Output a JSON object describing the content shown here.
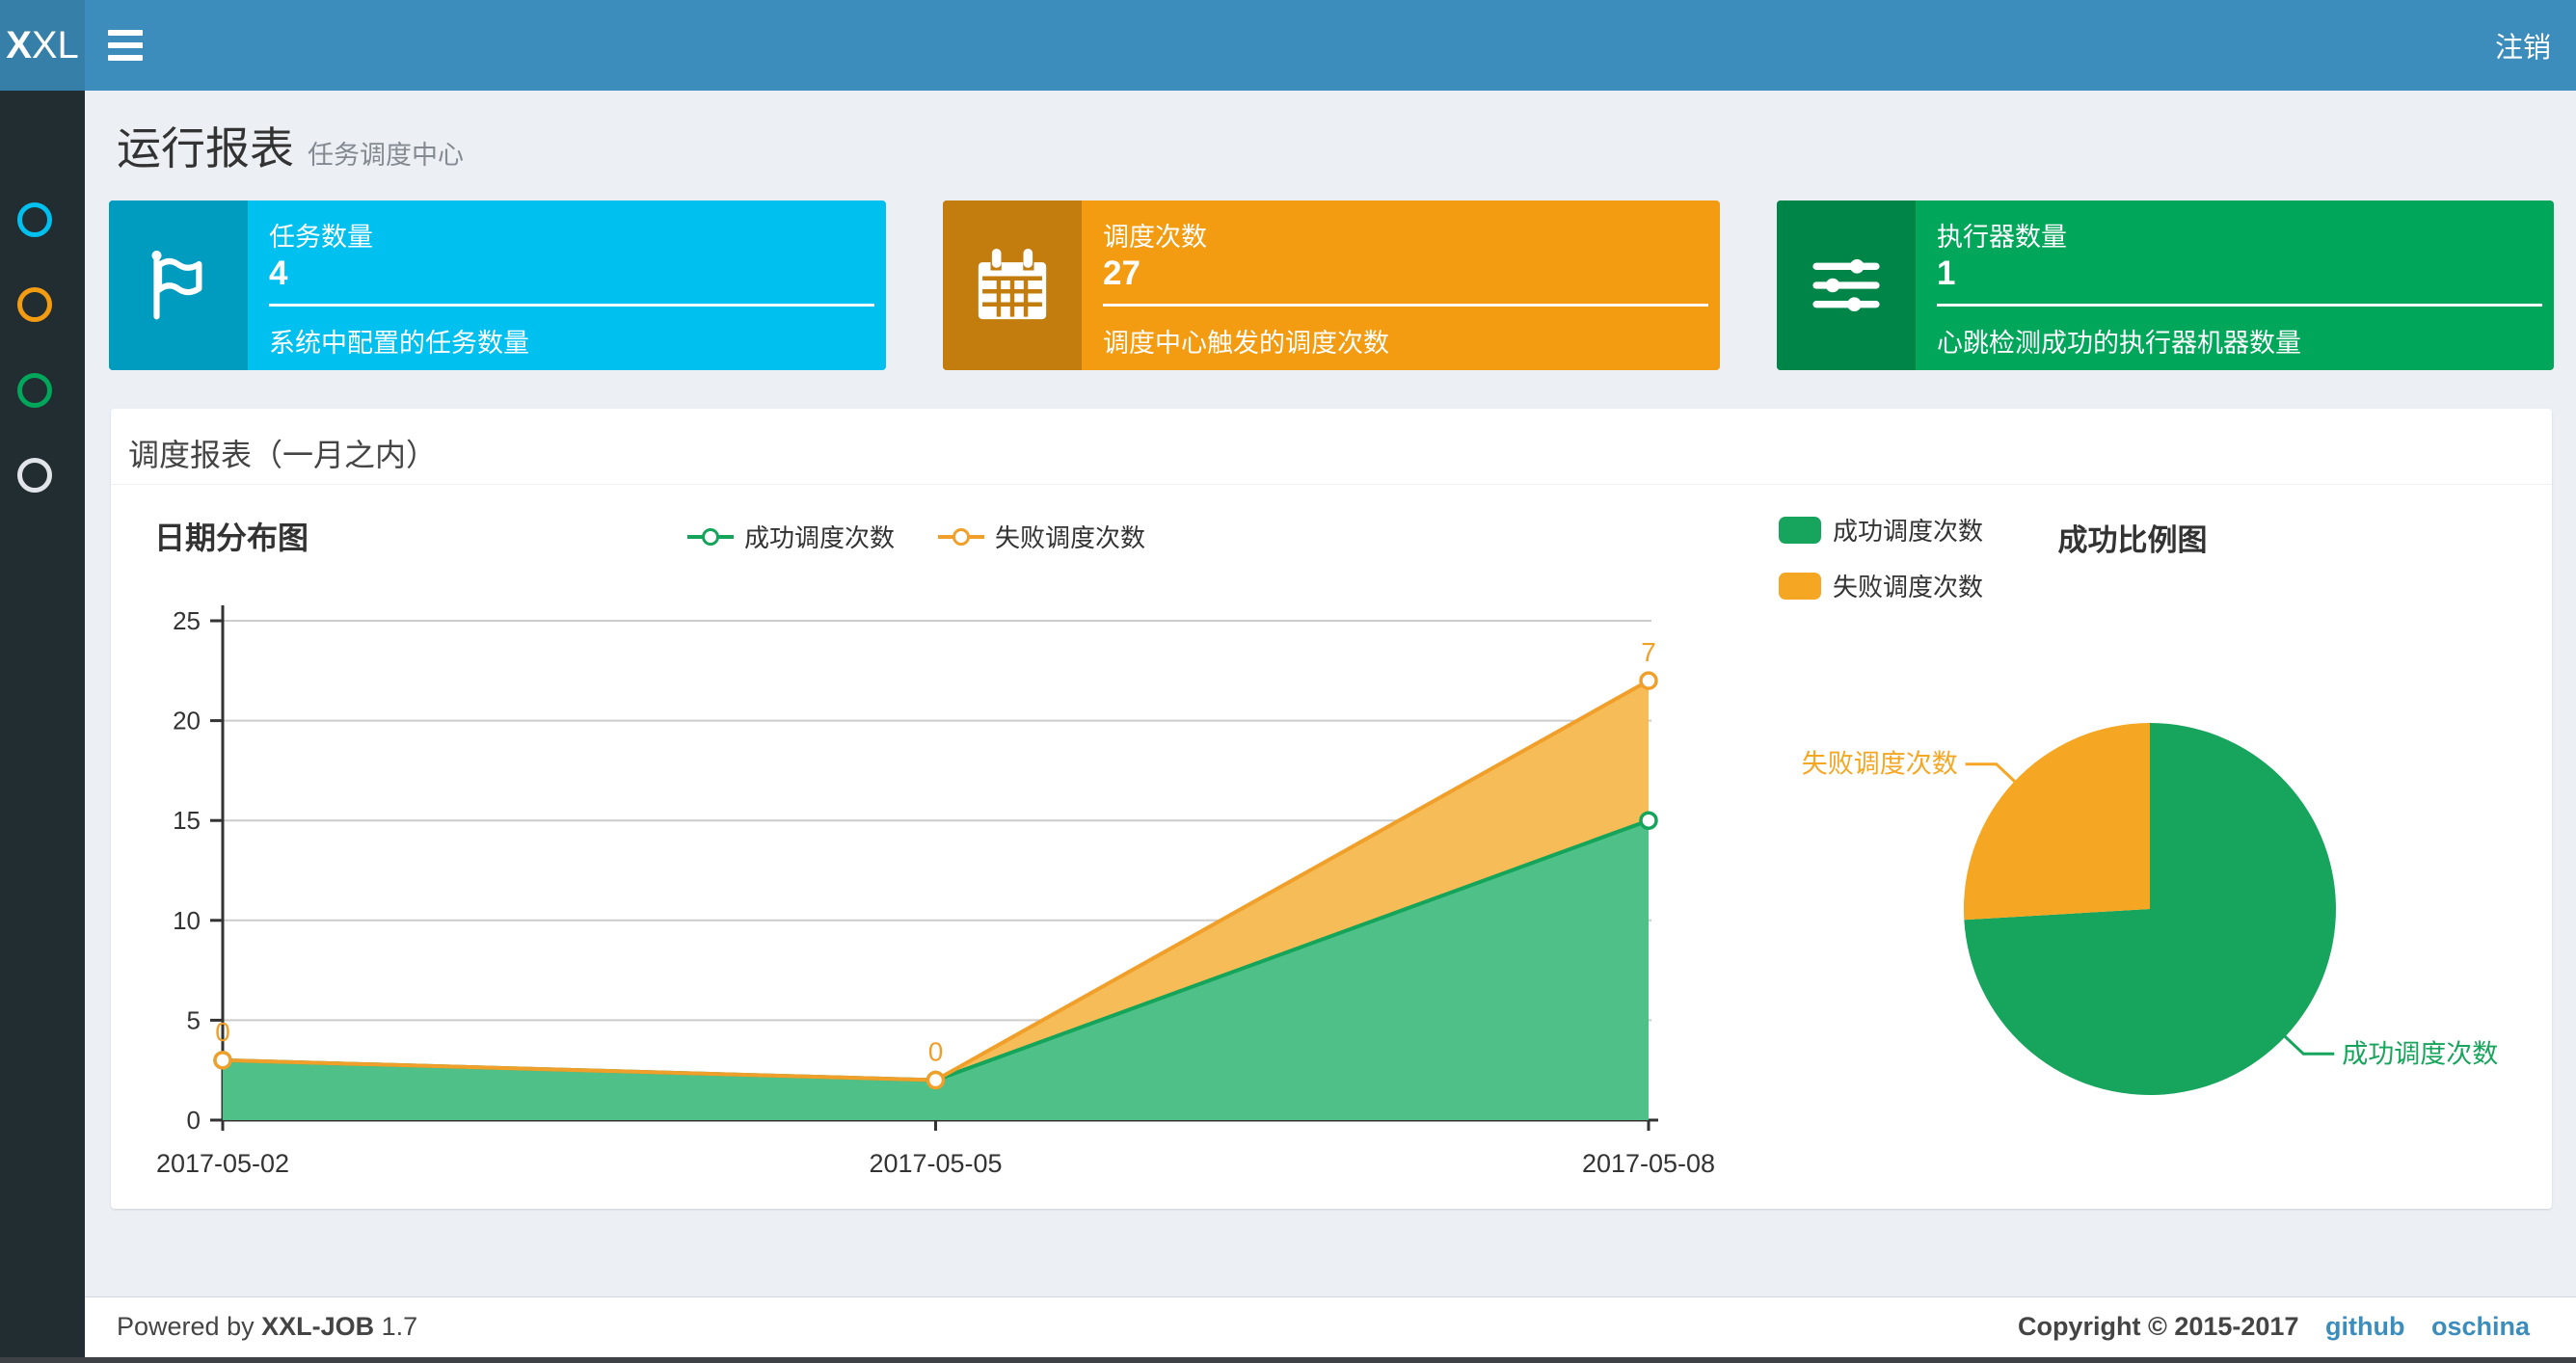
{
  "navbar": {
    "logo_bold": "X",
    "logo_rest": "XL",
    "logout": "注销"
  },
  "sidebar": {
    "items": [
      {
        "name": "menu-1",
        "icon": "circle-outline",
        "color": "aqua"
      },
      {
        "name": "menu-2",
        "icon": "circle-outline",
        "color": "orange"
      },
      {
        "name": "menu-3",
        "icon": "circle-outline",
        "color": "green"
      },
      {
        "name": "menu-4",
        "icon": "circle-outline",
        "color": "plain"
      }
    ]
  },
  "page": {
    "title": "运行报表",
    "subtitle": "任务调度中心"
  },
  "stat_cards": [
    {
      "label": "任务数量",
      "value": "4",
      "desc": "系统中配置的任务数量",
      "icon": "flag"
    },
    {
      "label": "调度次数",
      "value": "27",
      "desc": "调度中心触发的调度次数",
      "icon": "calendar"
    },
    {
      "label": "执行器数量",
      "value": "1",
      "desc": "心跳检测成功的执行器机器数量",
      "icon": "sliders"
    }
  ],
  "panel": {
    "title": "调度报表（一月之内）"
  },
  "footer": {
    "powered_prefix": "Powered by",
    "brand": "XXL-JOB",
    "version": "1.7",
    "copyright": "Copyright © 2015-2017",
    "links": [
      "github",
      "oschina"
    ]
  },
  "colors": {
    "navbar": "#3c8dbc",
    "logo-bg": "#367fa9",
    "sidebar-bg": "#222d32",
    "content-bg": "#ecf0f5",
    "box-aqua": "#00c0ef",
    "box-aqua-dark": "#009cbf",
    "box-orange": "#f39c12",
    "box-orange-dark": "#c27d0e",
    "box-green": "#00a65a",
    "box-green-dark": "#008549",
    "line-green": "#14a45a",
    "line-green-fill": "#50c089",
    "line-orange": "#f0a02a",
    "line-orange-fill": "#f6bc58",
    "pie-green": "#17a45c",
    "pie-orange": "#f5a623",
    "axis": "#333333",
    "grid": "#cccccc",
    "ring-plain": "#e1e5ea",
    "link": "#3c8dbc"
  },
  "chart_data": [
    {
      "type": "area",
      "title": "日期分布图",
      "stacked": true,
      "x": [
        "2017-05-02",
        "2017-05-05",
        "2017-05-08"
      ],
      "series": [
        {
          "name": "成功调度次数",
          "values": [
            3,
            2,
            15
          ],
          "color_key": "line-green",
          "fill_key": "line-green-fill"
        },
        {
          "name": "失败调度次数",
          "values": [
            0,
            0,
            7
          ],
          "color_key": "line-orange",
          "fill_key": "line-orange-fill"
        }
      ],
      "point_labels_series": 1,
      "point_labels": [
        "0",
        "0",
        "7"
      ],
      "ylim": [
        0,
        25
      ],
      "yticks": [
        0,
        5,
        10,
        15,
        20,
        25
      ],
      "grid": true,
      "legend_position": "top-center"
    },
    {
      "type": "pie",
      "title": "成功比例图",
      "slices": [
        {
          "label": "成功调度次数",
          "value": 20,
          "color_key": "pie-green"
        },
        {
          "label": "失败调度次数",
          "value": 7,
          "color_key": "pie-orange"
        }
      ],
      "legend_position": "top-left"
    }
  ]
}
